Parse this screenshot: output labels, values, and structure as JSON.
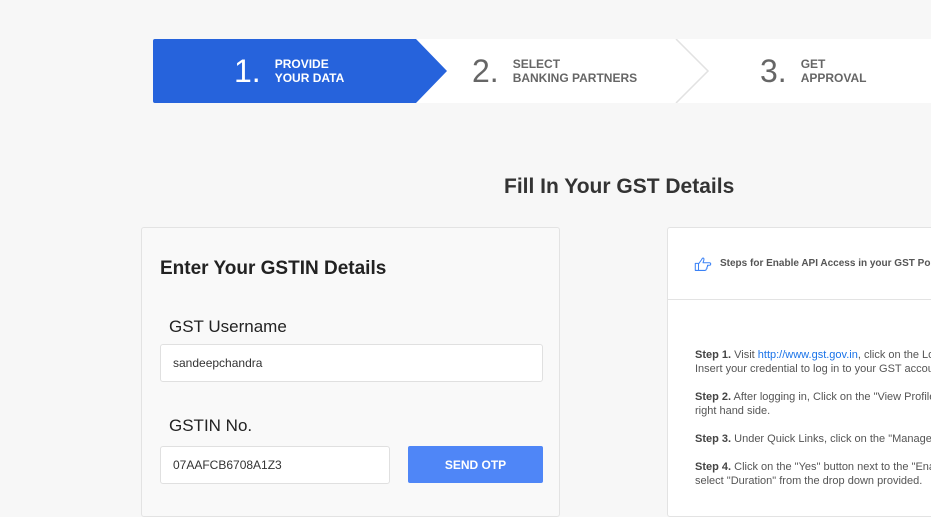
{
  "stepper": {
    "steps": [
      {
        "number": "1.",
        "line1": "PROVIDE",
        "line2": "YOUR DATA"
      },
      {
        "number": "2.",
        "line1": "SELECT",
        "line2": "BANKING PARTNERS"
      },
      {
        "number": "3.",
        "line1": "GET",
        "line2": "APPROVAL"
      }
    ],
    "active_color": "#2663dc"
  },
  "page": {
    "title": "Fill In Your GST Details"
  },
  "gstin_form": {
    "title": "Enter Your GSTIN Details",
    "username_label": "GST Username",
    "username_value": "sandeepchandra",
    "gstin_label": "GSTIN No.",
    "gstin_value": "07AAFCB6708A1Z3",
    "send_otp_label": "SEND OTP",
    "button_color": "#4f86f7"
  },
  "instructions": {
    "header": "Steps for Enable API Access in your GST Portal",
    "icon": "pointing-hand-icon",
    "steps": [
      {
        "label": "Step 1.",
        "text_before": " Visit ",
        "link": "http://www.gst.gov.in",
        "text_after": ", click on the Login button.",
        "line2": "Insert your credential to log in to your GST account."
      },
      {
        "label": "Step 2.",
        "text": " After logging in, Click on the \"View Profile\" option on the",
        "line2": "right hand side."
      },
      {
        "label": "Step 3.",
        "text": " Under Quick Links, click on the \"Manage API Access\" option."
      },
      {
        "label": "Step 4.",
        "text": " Click on the \"Yes\" button next to the \"Enable API Request\" and",
        "line2": "select \"Duration\" from the drop down provided."
      }
    ]
  }
}
